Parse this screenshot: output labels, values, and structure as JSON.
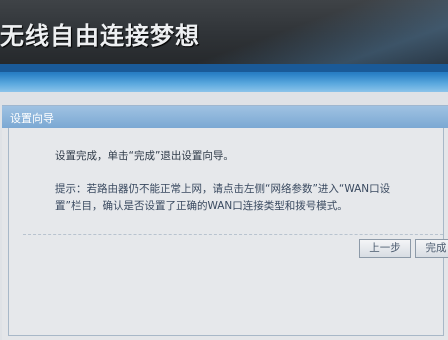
{
  "banner": {
    "title": "无线自由连接梦想"
  },
  "wizard": {
    "title": "设置向导",
    "message": "设置完成，单击“完成”退出设置向导。",
    "hint": "提示：若路由器仍不能正常上网，请点击左侧“网络参数”进入“WAN口设置”栏目，确认是否设置了正确的WAN口连接类型和拨号模式。",
    "buttons": {
      "prev_label": "上一步",
      "finish_label": "完成"
    }
  }
}
